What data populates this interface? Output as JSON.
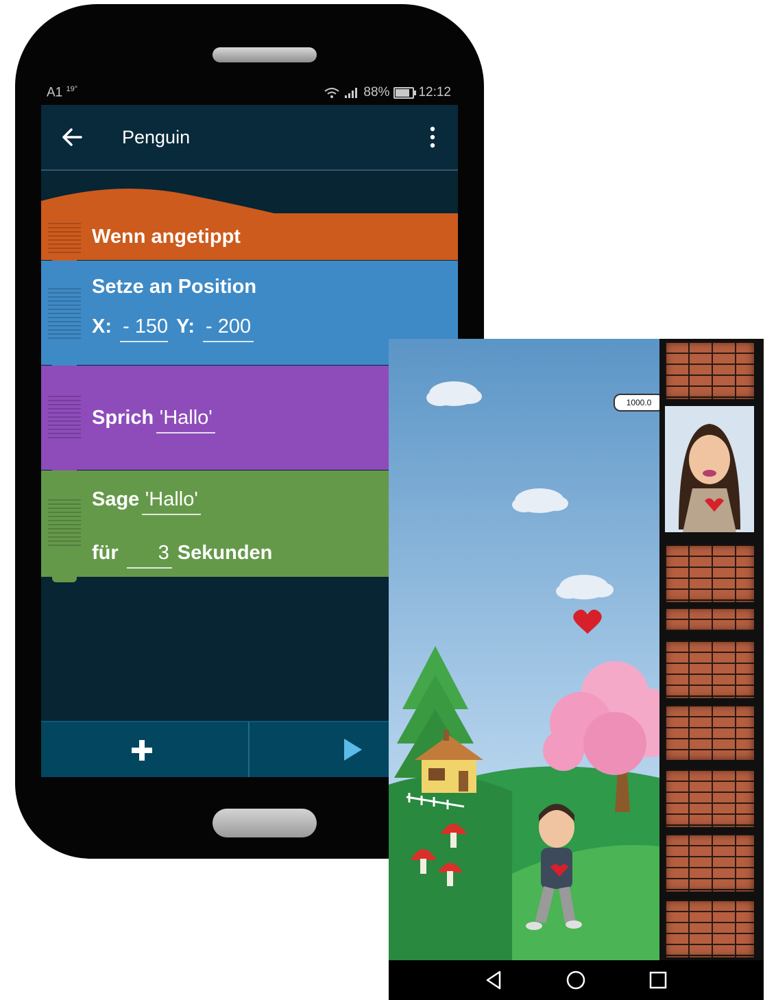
{
  "editor_phone": {
    "status_bar": {
      "carrier": "A1",
      "temperature": "19°",
      "battery": "88%",
      "time": "12:12"
    },
    "app_bar": {
      "title": "Penguin"
    },
    "blocks": {
      "when_tapped": "Wenn angetippt",
      "set_position": {
        "label": "Setze an Position",
        "x_label": "X:",
        "x_value": "- 150",
        "y_label": "Y:",
        "y_value": "- 200"
      },
      "say": {
        "label": "Sprich",
        "value": "'Hallo'"
      },
      "say_for": {
        "label": "Sage",
        "value": "'Hallo'",
        "for_label": "für",
        "seconds_value": "3",
        "seconds_label": "Sekunden"
      }
    },
    "colors": {
      "event_block": "#cd5b1d",
      "motion_block": "#3e8ac6",
      "look_block": "#8e4cbb",
      "sound_block": "#65994a",
      "screen_bg": "#072532"
    }
  },
  "game_phone": {
    "speech_bubble_text": "1000.0"
  }
}
